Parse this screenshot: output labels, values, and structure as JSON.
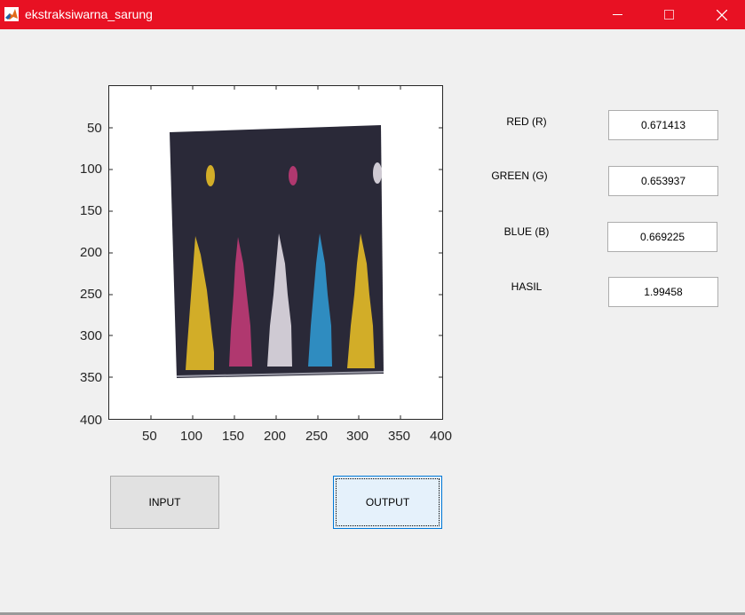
{
  "window": {
    "title": "ekstraksiwarna_sarung",
    "app_icon": "matlab-icon"
  },
  "axes": {
    "x_ticks": [
      "50",
      "100",
      "150",
      "200",
      "250",
      "300",
      "350",
      "400"
    ],
    "y_ticks": [
      "50",
      "100",
      "150",
      "200",
      "250",
      "300",
      "350",
      "400"
    ]
  },
  "fields": [
    {
      "label": "RED (R)",
      "value": "0.671413"
    },
    {
      "label": "GREEN (G)",
      "value": "0.653937"
    },
    {
      "label": "BLUE (B)",
      "value": "0.669225"
    },
    {
      "label": "HASIL",
      "value": "1.99458"
    }
  ],
  "buttons": {
    "input": "INPUT",
    "output": "OUTPUT"
  },
  "colors": {
    "titlebar": "#e81123",
    "sarung_base": "#2a2938",
    "pattern_yellow": "#d2ad28",
    "pattern_magenta": "#b0386f",
    "pattern_silver": "#cfcad3",
    "pattern_blue": "#2f8cc0"
  }
}
